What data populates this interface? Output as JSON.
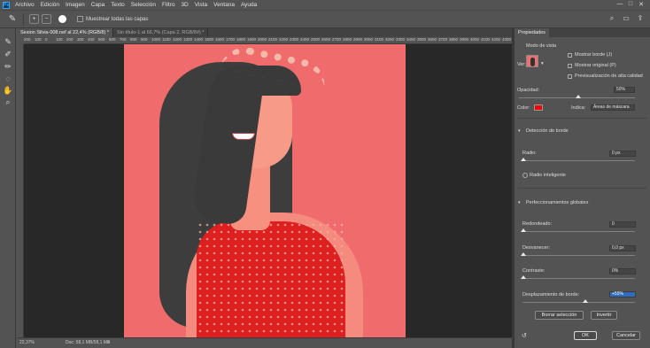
{
  "menubar": {
    "logo": "Ps",
    "items": [
      "Archivo",
      "Edición",
      "Imagen",
      "Capa",
      "Texto",
      "Selección",
      "Filtro",
      "3D",
      "Vista",
      "Ventana",
      "Ayuda"
    ],
    "window_controls": [
      "—",
      "□",
      "✕"
    ]
  },
  "options_bar": {
    "tool_icon": "brush-icon",
    "checkbox_label": "Muestrear todas las capas",
    "brush_size": "11"
  },
  "tabs": [
    {
      "label": "Sesion Silvia-008.nef al 22,4% (RGB/8) *",
      "active": true
    },
    {
      "label": "Sin título-1 al 66,7% (Capa 2, RGB/8#) *",
      "active": false
    }
  ],
  "ruler": {
    "ticks": [
      "200",
      "100",
      "0",
      "100",
      "200",
      "300",
      "400",
      "500",
      "600",
      "700",
      "800",
      "900",
      "1000",
      "1100",
      "1200",
      "1300",
      "1400",
      "1500",
      "1600",
      "1700",
      "1800",
      "1900",
      "2000",
      "2100",
      "2200",
      "2300",
      "2400",
      "2500",
      "2600",
      "2700",
      "2800",
      "2900",
      "3000",
      "3100",
      "3200",
      "3300",
      "3400",
      "3500",
      "3600",
      "3700",
      "3800",
      "3900",
      "4000",
      "4100",
      "4200",
      "4300",
      "4500"
    ]
  },
  "status": {
    "zoom": "22,37%",
    "doc": "Doc: 58,1 MB/58,1 MB",
    "arrow": ">"
  },
  "panel": {
    "tab": "Propiedades",
    "view_mode": "Modo de vista",
    "ver_label": "Ver:",
    "show_edge": "Mostrar borde (J)",
    "show_original": "Mostrar original (P)",
    "hq_preview": "Previsualización de alta calidad",
    "opacity_label": "Opacidad:",
    "opacity_value": "50%",
    "color_label": "Color:",
    "color_value": "#ee0000",
    "indicates_label": "Indica:",
    "indicates_value": "Áreas de máscara",
    "edge_detection": "Detección de borde",
    "radius_label": "Radio:",
    "radius_value": "0 px",
    "smart_radius": "Radio inteligente",
    "global_refine": "Perfeccionamientos globales",
    "smooth_label": "Redondeado:",
    "smooth_value": "0",
    "feather_label": "Desvanecer:",
    "feather_value": "0,0 px",
    "contrast_label": "Contraste:",
    "contrast_value": "0%",
    "shift_edge_label": "Desplazamiento de borde:",
    "shift_edge_value": "+55%",
    "clear_selection": "Borrar selección",
    "invert": "Invertir",
    "ok": "OK",
    "cancel": "Cancelar"
  }
}
